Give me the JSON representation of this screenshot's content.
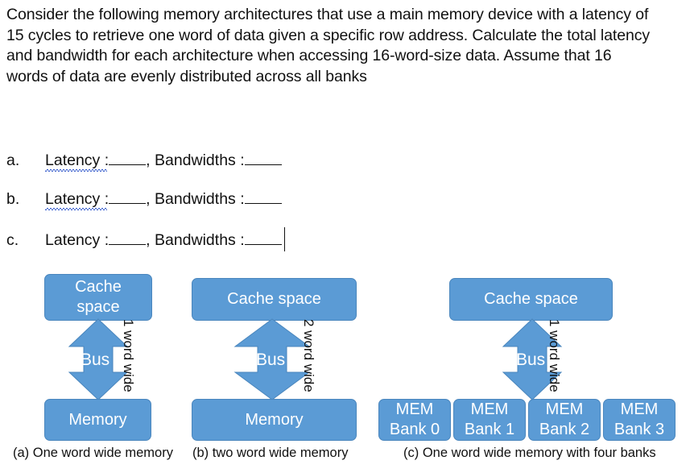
{
  "question": {
    "text": "Consider the following memory architectures that use a main memory device with a latency of 15 cycles to retrieve one word of data given a specific row address. Calculate the total latency and bandwidth for each architecture when accessing 16-word-size data. Assume that 16 words of data are evenly distributed across all banks"
  },
  "answers": {
    "label_latency": "Latency :",
    "label_bandwidths": ", Bandwidths :",
    "items": [
      {
        "marker": "a.",
        "latency_label": "Latency :",
        "bandwidth_label": ", Bandwidths :",
        "spellcheck": true,
        "caret": false
      },
      {
        "marker": "b.",
        "latency_label": "Latency :",
        "bandwidth_label": ", Bandwidths :",
        "spellcheck": true,
        "caret": false
      },
      {
        "marker": "c.",
        "latency_label": "Latency :",
        "bandwidth_label": ", Bandwidths :",
        "spellcheck": false,
        "caret": true
      }
    ]
  },
  "colors": {
    "box_fill": "#5B9BD5",
    "box_border": "#4A86BD",
    "box_text": "#FFFFFF",
    "body_text": "#111111",
    "spellcheck_underline": "#3A5FCD",
    "background": "#FFFFFF"
  },
  "diagrams": [
    {
      "id": "a",
      "top_box": "Cache space",
      "top_box_lines": [
        "Cache",
        "space"
      ],
      "bus_label": "Bus",
      "width_label": "1 word wide",
      "bottom_boxes": [
        "Memory"
      ],
      "caption": "(a) One word wide memory"
    },
    {
      "id": "b",
      "top_box": "Cache space",
      "top_box_lines": [
        "Cache space"
      ],
      "bus_label": "Bus",
      "width_label": "2 word wide",
      "bottom_boxes": [
        "Memory"
      ],
      "caption": "(b) two word wide memory"
    },
    {
      "id": "c",
      "top_box": "Cache space",
      "top_box_lines": [
        "Cache space"
      ],
      "bus_label": "Bus",
      "width_label": "1 word wide",
      "bottom_boxes": [
        "MEM\nBank 0",
        "MEM\nBank 1",
        "MEM\nBank 2",
        "MEM\nBank 3"
      ],
      "bank_lines": [
        [
          "MEM",
          "Bank 0"
        ],
        [
          "MEM",
          "Bank 1"
        ],
        [
          "MEM",
          "Bank 2"
        ],
        [
          "MEM",
          "Bank 3"
        ]
      ],
      "caption": "(c) One word wide memory with four banks"
    }
  ]
}
